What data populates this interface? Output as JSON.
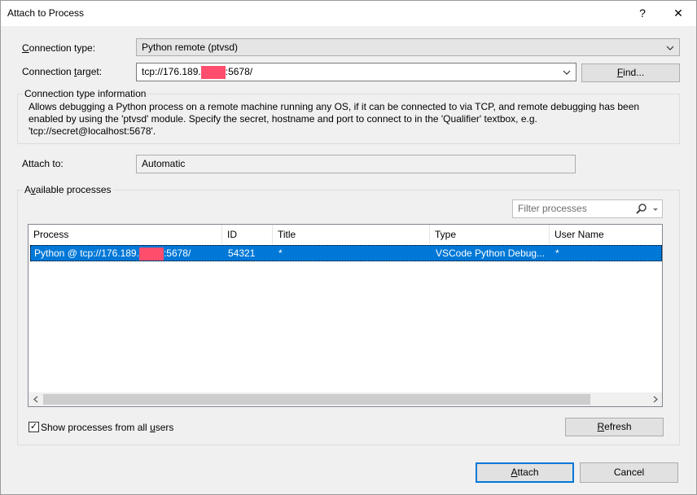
{
  "window": {
    "title": "Attach to Process",
    "help_glyph": "?",
    "close_glyph": "✕"
  },
  "connection_type": {
    "label_pre": "",
    "label_accel": "C",
    "label_post": "onnection type:",
    "value": "Python remote (ptvsd)"
  },
  "connection_target": {
    "label_pre": "Connection ",
    "label_accel": "t",
    "label_post": "arget:",
    "value_prefix": "tcp://176.189.",
    "value_suffix": ":5678/",
    "find_pre": "",
    "find_accel": "F",
    "find_post": "ind..."
  },
  "info": {
    "title": "Connection type information",
    "line1": "Allows debugging a Python process on a remote machine running any OS, if it can be connected to via TCP, and remote debugging has been",
    "line2": "enabled by using the 'ptvsd' module. Specify the secret, hostname and port to connect to in the 'Qualifier' textbox, e.g.",
    "line3": "'tcp://secret@localhost:5678'."
  },
  "attach_to": {
    "label": "Attach to:",
    "value": "Automatic"
  },
  "available": {
    "title_pre": "A",
    "title_accel": "v",
    "title_post": "ailable processes",
    "filter_placeholder": "Filter processes",
    "columns": [
      "Process",
      "ID",
      "Title",
      "Type",
      "User Name"
    ],
    "rows": [
      {
        "process_prefix": "Python @ tcp://176.189.",
        "process_suffix": ":5678/",
        "id": "54321",
        "title": "*",
        "type": "VSCode Python Debug...",
        "user": "*"
      }
    ],
    "show_all_pre": "Show processes from all ",
    "show_all_accel": "u",
    "show_all_post": "sers",
    "show_all_checked": "✓",
    "refresh_pre": "",
    "refresh_accel": "R",
    "refresh_post": "efresh"
  },
  "footer": {
    "attach_pre": "",
    "attach_accel": "A",
    "attach_post": "ttach",
    "cancel_label": "Cancel"
  },
  "colors": {
    "selection": "#0078d7",
    "redaction": "#ff4d6d"
  },
  "icons": {
    "dropdown": "chevron-down-icon",
    "search": "search-icon",
    "help": "help-icon",
    "close": "close-icon"
  }
}
